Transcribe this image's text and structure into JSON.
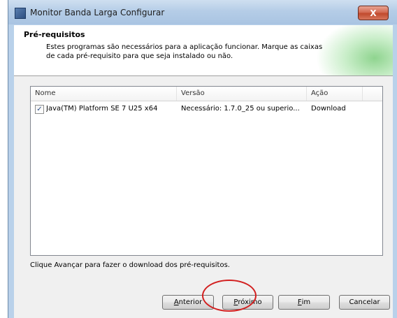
{
  "window": {
    "title": "Monitor Banda Larga Configurar",
    "close_label": "X"
  },
  "header": {
    "title": "Pré-requisitos",
    "description": "Estes programas são necessários para a aplicação funcionar. Marque as caixas de cada pré-requisito para que seja instalado ou não."
  },
  "list": {
    "columns": [
      "Nome",
      "Versão",
      "Ação"
    ],
    "rows": [
      {
        "checked": true,
        "check_glyph": "✓",
        "name": "Java(TM) Platform SE 7 U25 x64",
        "version": "Necessário: 1.7.0_25 ou superio...",
        "action": "Download"
      }
    ]
  },
  "footer": {
    "text": "Clique Avançar para fazer o download dos pré-requisitos."
  },
  "buttons": {
    "back_first": "A",
    "back_rest": "nterior",
    "next_first": "P",
    "next_rest": "róximo",
    "finish_first": "F",
    "finish_rest": "im",
    "cancel": "Cancelar"
  },
  "annotation": {
    "color": "#d21f1f"
  }
}
